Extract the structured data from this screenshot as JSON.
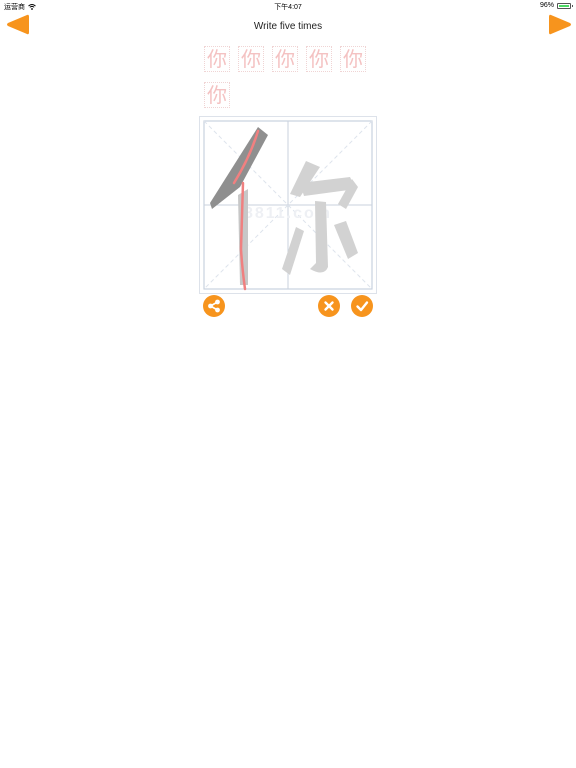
{
  "status_bar": {
    "carrier": "运营商",
    "time": "下午4:07",
    "battery": "96%",
    "battery_level": 0.96
  },
  "header": {
    "title": "Write five times"
  },
  "colors": {
    "accent": "#f7941d",
    "trace": "#f08080",
    "guide": "#c8c8c8"
  },
  "character": "你",
  "practice": {
    "characters": [
      "你",
      "你",
      "你",
      "你",
      "你",
      "你"
    ]
  },
  "watermark": "8811.com"
}
